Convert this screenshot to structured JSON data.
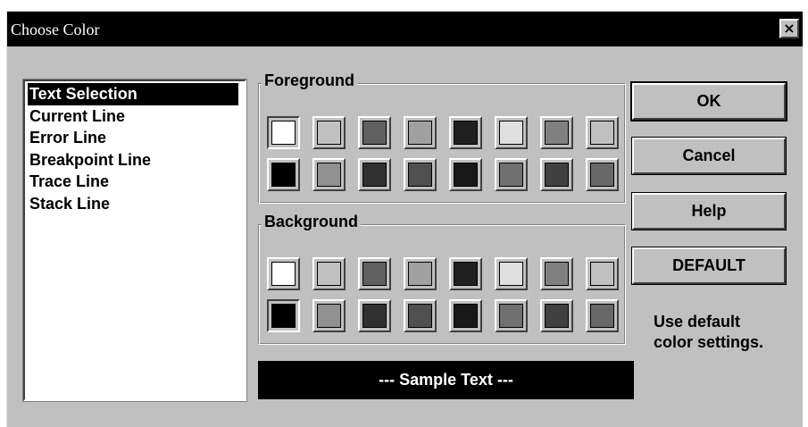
{
  "window": {
    "title": "Choose Color",
    "close_label": "×"
  },
  "list": {
    "selected_index": 0,
    "items": [
      "Text Selection",
      "Current Line",
      "Error Line",
      "Breakpoint Line",
      "Trace Line",
      "Stack Line"
    ]
  },
  "foreground": {
    "label": "Foreground",
    "selected_index": 0,
    "colors": [
      "#ffffff",
      "#c0c0c0",
      "#606060",
      "#a0a0a0",
      "#202020",
      "#e0e0e0",
      "#808080",
      "#c0c0c0",
      "#000000",
      "#909090",
      "#303030",
      "#505050",
      "#181818",
      "#707070",
      "#404040",
      "#686868"
    ]
  },
  "background": {
    "label": "Background",
    "selected_index": 8,
    "colors": [
      "#ffffff",
      "#c0c0c0",
      "#606060",
      "#a0a0a0",
      "#202020",
      "#e0e0e0",
      "#808080",
      "#c0c0c0",
      "#000000",
      "#909090",
      "#303030",
      "#505050",
      "#181818",
      "#707070",
      "#404040",
      "#686868"
    ]
  },
  "sample": {
    "text": "--- Sample Text ---",
    "fg_color": "#ffffff",
    "bg_color": "#000000"
  },
  "buttons": {
    "ok": "OK",
    "cancel": "Cancel",
    "help": "Help",
    "default": "DEFAULT"
  },
  "hint": {
    "line1": "Use default",
    "line2": "color settings."
  }
}
